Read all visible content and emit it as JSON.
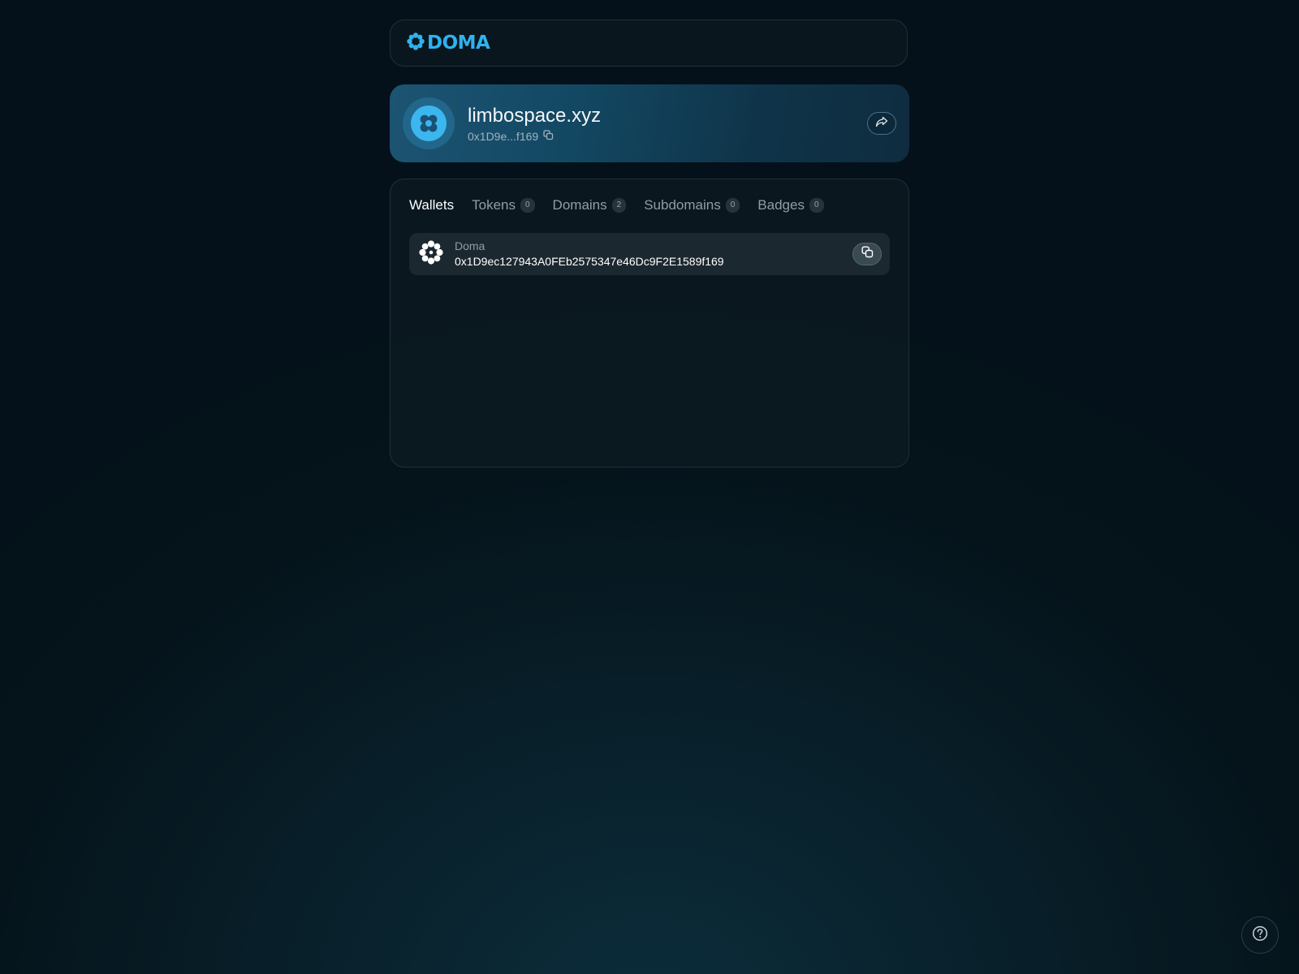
{
  "header": {
    "logo_text": "DOMA",
    "logo_icon": "doma-flower-icon"
  },
  "profile": {
    "domain_name": "limbospace.xyz",
    "short_address": "0x1D9e...f169",
    "copy_icon": "copy-icon",
    "share_icon": "share-icon",
    "colors": {
      "avatar_ring": "#22678b",
      "avatar_fill": "#3cb6ef",
      "card_gradient_start": "#1c5472",
      "card_gradient_end": "#0f2c3f"
    }
  },
  "tabs": [
    {
      "label": "Wallets",
      "count": null,
      "active": true
    },
    {
      "label": "Tokens",
      "count": "0",
      "active": false
    },
    {
      "label": "Domains",
      "count": "2",
      "active": false
    },
    {
      "label": "Subdomains",
      "count": "0",
      "active": false
    },
    {
      "label": "Badges",
      "count": "0",
      "active": false
    }
  ],
  "wallets": [
    {
      "network": "Doma",
      "address": "0x1D9ec127943A0FEb2575347e46Dc9F2E1589f169",
      "icon": "doma-network-icon"
    }
  ],
  "help": {
    "icon": "help-icon"
  },
  "colors": {
    "brand": "#2fb2ee",
    "background": "#05141b"
  }
}
